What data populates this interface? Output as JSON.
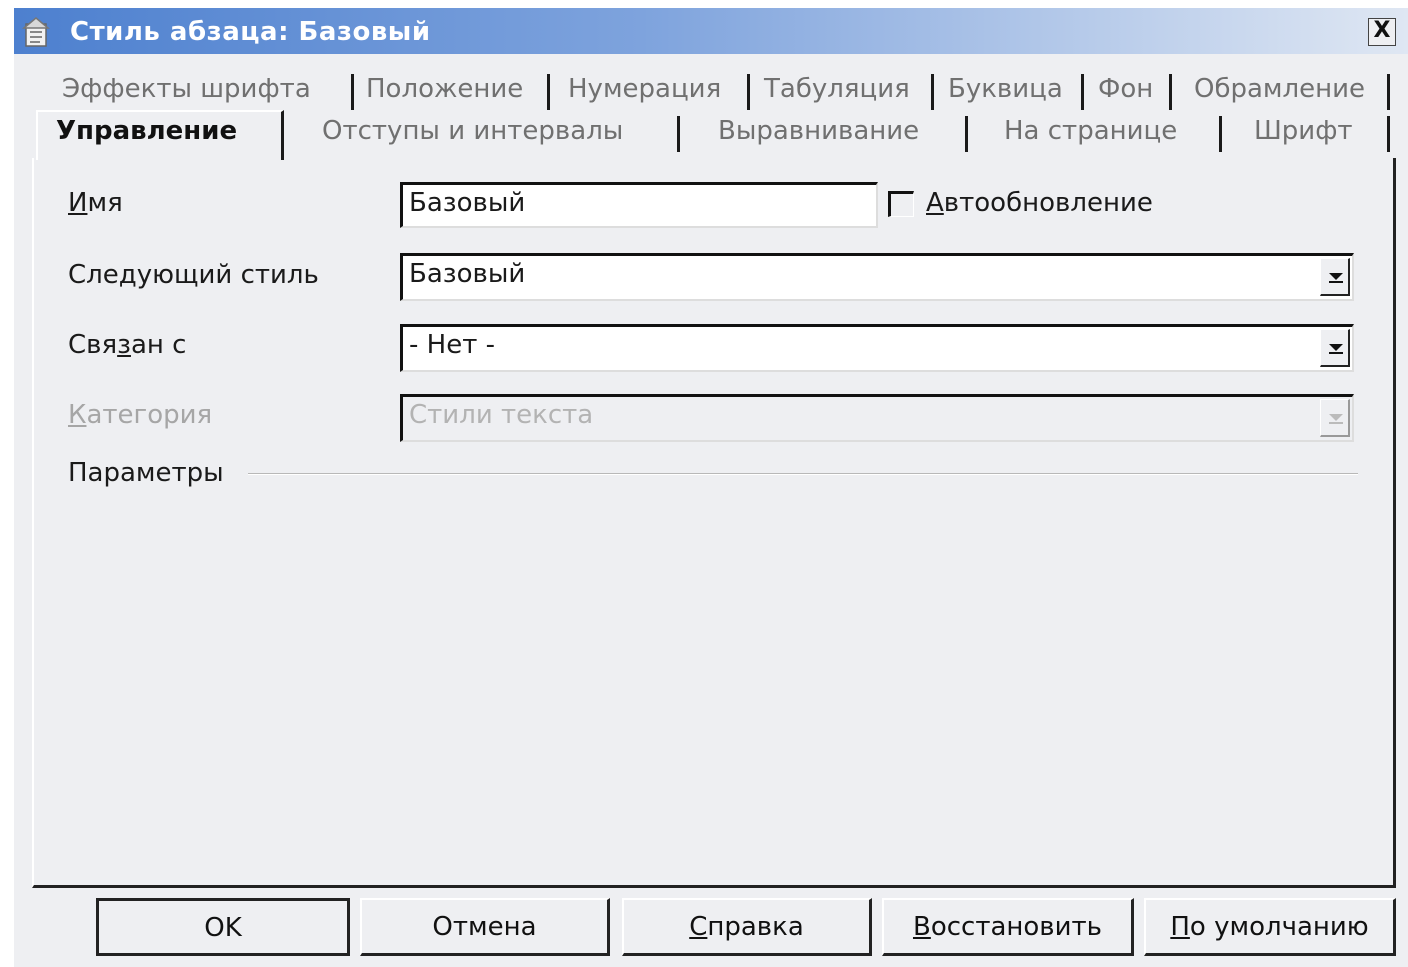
{
  "window": {
    "title": "Стиль абзаца: Базовый",
    "close_label": "X"
  },
  "tabs_row1": [
    {
      "label": "Эффекты шрифта"
    },
    {
      "label": "Положение"
    },
    {
      "label": "Нумерация"
    },
    {
      "label": "Табуляция"
    },
    {
      "label": "Буквица"
    },
    {
      "label": "Фон"
    },
    {
      "label": "Обрамление"
    }
  ],
  "tabs_row2": [
    {
      "label": "Управление",
      "active": true
    },
    {
      "label": "Отступы и интервалы"
    },
    {
      "label": "Выравнивание"
    },
    {
      "label": "На странице"
    },
    {
      "label": "Шрифт"
    }
  ],
  "form": {
    "name_label_key": "И",
    "name_label_rest": "мя",
    "name_value": "Базовый",
    "autoupdate_key": "А",
    "autoupdate_rest": "втообновление",
    "autoupdate_checked": false,
    "next_style_label_pre": "Сле",
    "next_style_label_key": "д",
    "next_style_label_post": "ующий стиль",
    "next_style_value": "Базовый",
    "linked_label_pre": "Свя",
    "linked_label_key": "з",
    "linked_label_post": "ан с",
    "linked_value": "- Нет -",
    "category_label_key": "К",
    "category_label_rest": "атегория",
    "category_value": "Стили текста",
    "params_label": "Параметры"
  },
  "buttons": {
    "ok": "OK",
    "cancel": "Отмена",
    "help_key": "С",
    "help_rest": "правка",
    "reset_key": "В",
    "reset_rest": "осстановить",
    "default_key": "П",
    "default_rest": "о умолчанию"
  }
}
